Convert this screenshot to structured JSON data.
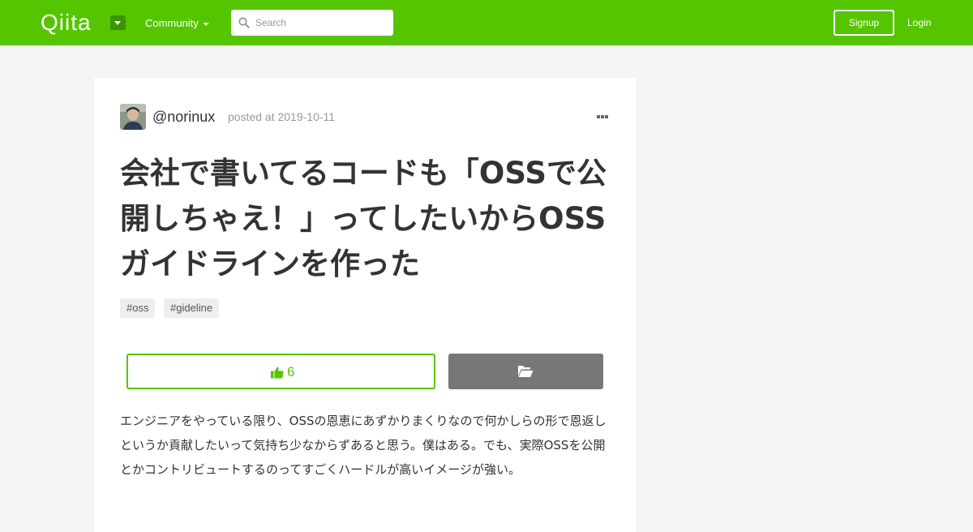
{
  "header": {
    "logo": "Qiita",
    "community_label": "Community",
    "search": {
      "placeholder": "Search",
      "value": ""
    },
    "signup_label": "Signup",
    "login_label": "Login"
  },
  "article": {
    "author": "@norinux",
    "posted_label": "posted at 2019-10-11",
    "title": "会社で書いてるコードも「OSSで公開しちゃえ！」ってしたいからOSSガイドラインを作った",
    "tags": [
      "#oss",
      "#gideline"
    ],
    "like_count": "6",
    "body": "エンジニアをやっている限り、OSSの恩恵にあずかりまくりなので何かしらの形で恩返しというか貢献したいって気持ち少なからずあると思う。僕はある。でも、実際OSSを公開とかコントリビュートするのってすごくハードルが高いイメージが強い。"
  },
  "colors": {
    "brand_green": "#55c500",
    "toggle_green": "#3e9400",
    "stock_gray": "#777777",
    "page_bg": "#f5f5f5"
  },
  "icons": {
    "logo_toggle": "caret-down-icon",
    "search": "search-icon",
    "menu": "more-dots-icon",
    "like": "thumbs-up-icon",
    "stock": "folder-open-icon"
  }
}
